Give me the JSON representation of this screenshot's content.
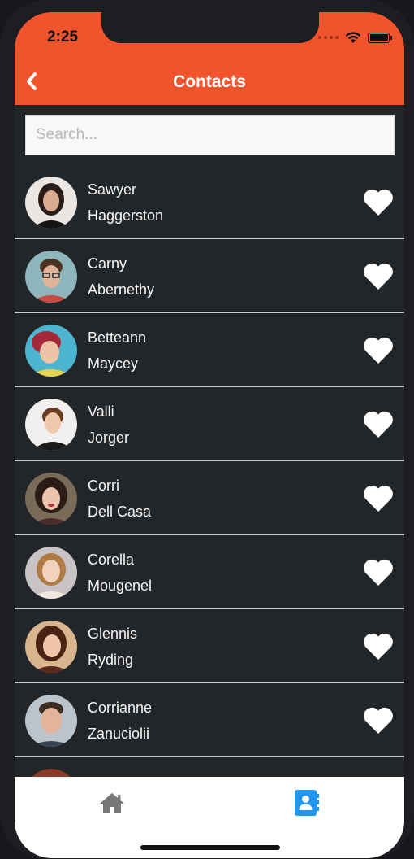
{
  "status_bar": {
    "time": "2:25"
  },
  "header": {
    "title": "Contacts",
    "accent_color": "#f1532c"
  },
  "search": {
    "placeholder": "Search...",
    "value": ""
  },
  "contacts": [
    {
      "first": "Sawyer",
      "last": "Haggerston"
    },
    {
      "first": "Carny",
      "last": "Abernethy"
    },
    {
      "first": "Betteann",
      "last": "Maycey"
    },
    {
      "first": "Valli",
      "last": "Jorger"
    },
    {
      "first": "Corri",
      "last": "Dell Casa"
    },
    {
      "first": "Corella",
      "last": "Mougenel"
    },
    {
      "first": "Glennis",
      "last": "Ryding"
    },
    {
      "first": "Corrianne",
      "last": "Zanuciolii"
    },
    {
      "first": "",
      "last": ""
    }
  ],
  "icons": {
    "back": "chevron-left-icon",
    "favorite": "heart-icon",
    "tab_home": "home-icon",
    "tab_contacts": "contacts-book-icon"
  },
  "tabbar": {
    "active_tab": "contacts",
    "active_color": "#2196f3",
    "inactive_color": "#777777"
  }
}
